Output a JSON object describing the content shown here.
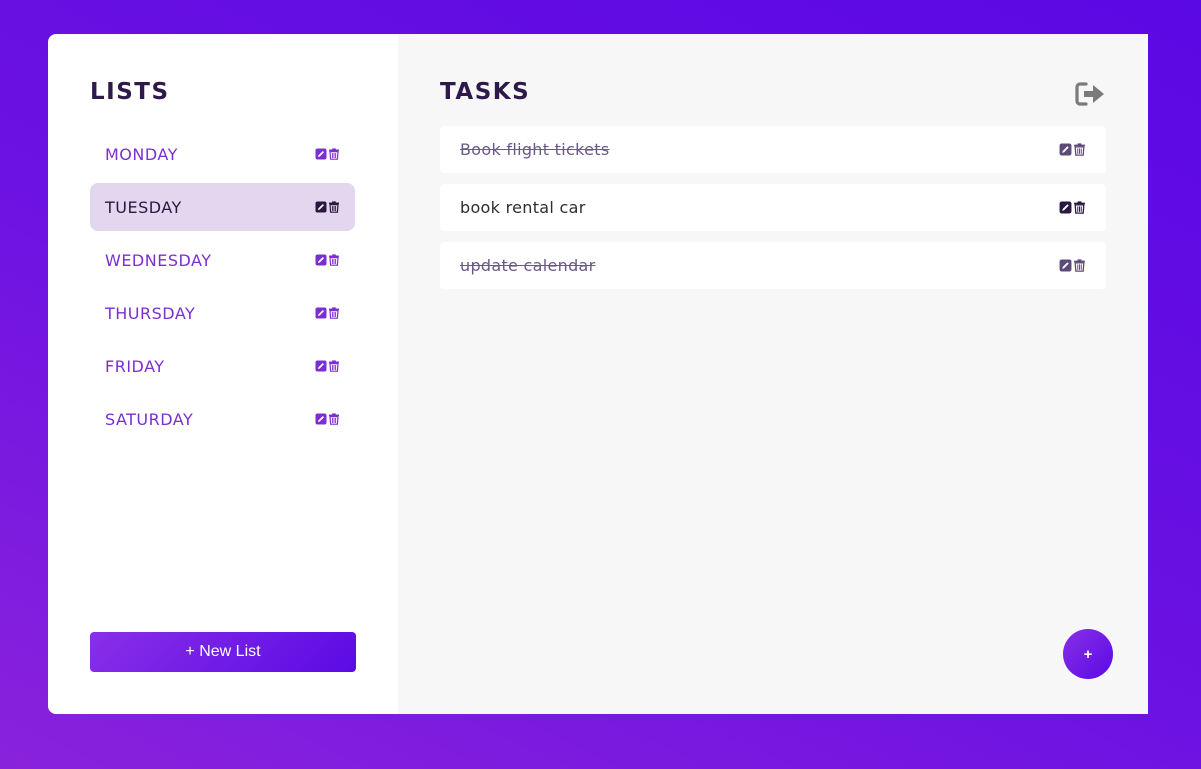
{
  "lists_panel": {
    "title": "LISTS",
    "items": [
      {
        "label": "MONDAY",
        "active": false
      },
      {
        "label": "TUESDAY",
        "active": true
      },
      {
        "label": "WEDNESDAY",
        "active": false
      },
      {
        "label": "THURSDAY",
        "active": false
      },
      {
        "label": "FRIDAY",
        "active": false
      },
      {
        "label": "SATURDAY",
        "active": false
      }
    ],
    "new_list_label": "+ New List"
  },
  "tasks_panel": {
    "title": "TASKS",
    "tasks": [
      {
        "text": "Book flight tickets",
        "done": true
      },
      {
        "text": "book rental car",
        "done": false
      },
      {
        "text": "update calendar",
        "done": true
      }
    ],
    "add_label": "+"
  },
  "icons": {
    "edit": "edit-icon",
    "delete": "trash-icon",
    "logout": "logout-icon"
  },
  "colors": {
    "accent": "#7b2fd0",
    "active_bg": "#e3d6ef",
    "dark_text": "#2d1a4a",
    "background_gradient_start": "#5a08e4",
    "background_gradient_end": "#8a22dc"
  }
}
